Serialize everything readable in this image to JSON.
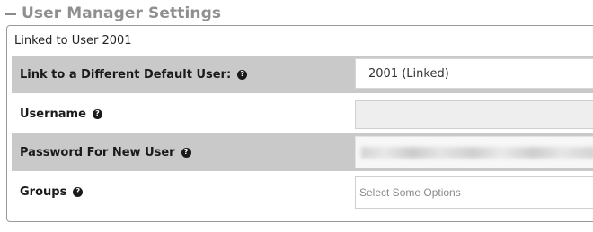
{
  "section": {
    "title": "User Manager Settings",
    "collapse_icon": "minus-icon"
  },
  "linked_status": "Linked to User 2001",
  "fields": {
    "default_user": {
      "label": "Link to a Different Default User:",
      "help_icon": "question-circle-icon",
      "value": "2001 (Linked)"
    },
    "username": {
      "label": "Username",
      "help_icon": "question-circle-icon",
      "value": ""
    },
    "password": {
      "label": "Password For New User",
      "help_icon": "question-circle-icon",
      "value": ""
    },
    "groups": {
      "label": "Groups",
      "help_icon": "question-circle-icon",
      "placeholder": "Select Some Options"
    }
  },
  "colors": {
    "shaded_row": "#c9c9c9",
    "title_gray": "#8f8f8f",
    "border": "#9a9a9a"
  }
}
